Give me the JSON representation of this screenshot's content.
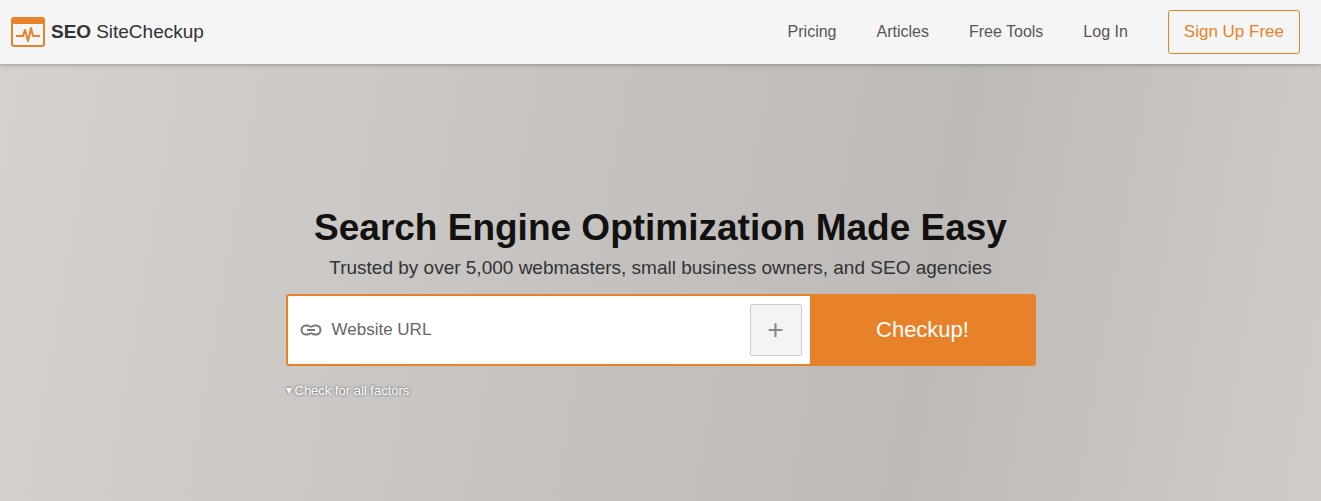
{
  "logo": {
    "bold": "SEO",
    "text": "SiteCheckup"
  },
  "nav": [
    {
      "label": "Pricing"
    },
    {
      "label": "Articles"
    },
    {
      "label": "Free Tools"
    },
    {
      "label": "Log In"
    }
  ],
  "signup": "Sign Up Free",
  "hero": {
    "title": "Search Engine Optimization Made Easy",
    "subtitle": "Trusted by over 5,000 webmasters, small business owners, and SEO agencies",
    "placeholder": "Website URL",
    "add": "+",
    "button": "Checkup!",
    "toggle_icon": "▾",
    "toggle": "Check for all factors"
  }
}
